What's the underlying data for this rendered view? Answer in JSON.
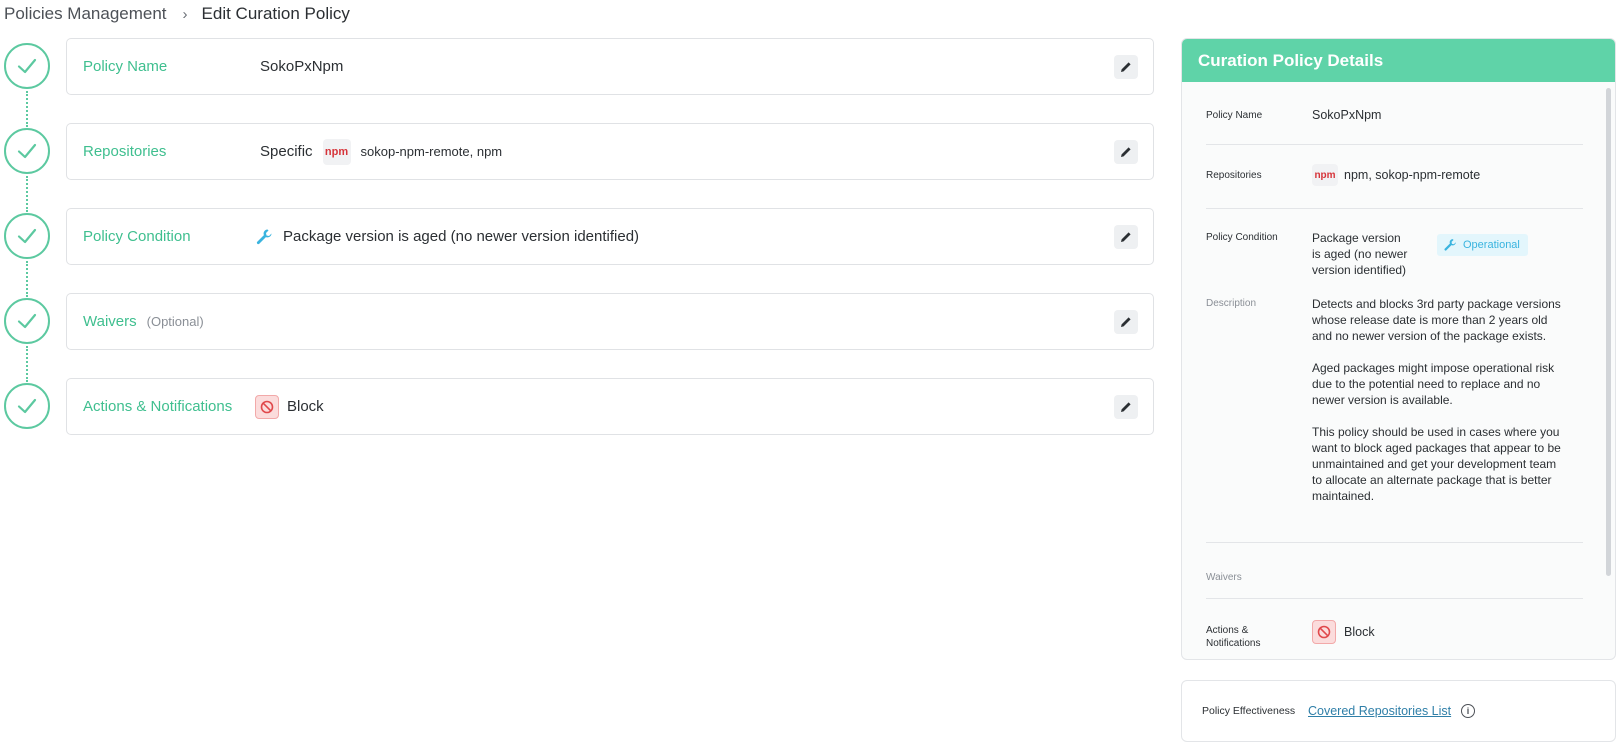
{
  "breadcrumb": {
    "parent": "Policies Management",
    "separator": "›",
    "current": "Edit Curation Policy"
  },
  "steps": [
    {
      "label": "Policy Name",
      "value": "SokoPxNpm",
      "status": "complete"
    },
    {
      "label": "Repositories",
      "scope": "Specific",
      "repo_type": "npm",
      "repos": "sokop-npm-remote, npm",
      "status": "complete"
    },
    {
      "label": "Policy Condition",
      "value": "Package version is aged (no newer version identified)",
      "icon": "wrench-icon",
      "status": "complete"
    },
    {
      "label": "Waivers",
      "optional_text": "(Optional)",
      "status": "complete"
    },
    {
      "label": "Actions & Notifications",
      "value": "Block",
      "icon": "block-icon",
      "status": "complete"
    }
  ],
  "details": {
    "title": "Curation Policy Details",
    "policy_name_label": "Policy Name",
    "policy_name": "SokoPxNpm",
    "repositories_label": "Repositories",
    "repo_type": "npm",
    "repositories": "npm,  sokop-npm-remote",
    "policy_condition_label": "Policy Condition",
    "condition_line1": "Package version",
    "condition_line2": "is aged (no newer",
    "condition_line3": "version identified)",
    "condition_badge": "Operational",
    "description_label": "Description",
    "description_p1": "Detects and blocks 3rd party package versions whose release date is more than 2 years old and no newer version of the package exists.",
    "description_p2": "Aged packages might impose operational risk due to the potential need to replace and no newer version is available.",
    "description_p3": "This policy should be used in cases where you want to block aged packages that appear to be unmaintained and get your development team to allocate an alternate package that is better maintained.",
    "waivers_label": "Waivers",
    "actions_label": "Actions & Notifications",
    "action_value": "Block"
  },
  "effectiveness": {
    "label": "Policy Effectiveness",
    "link": "Covered Repositories List"
  },
  "colors": {
    "accent_green": "#5cc9a0",
    "header_green": "#5fd3a8",
    "npm_red": "#d6343a",
    "operational_blue": "#3ab4df",
    "block_red": "#e0484b"
  }
}
